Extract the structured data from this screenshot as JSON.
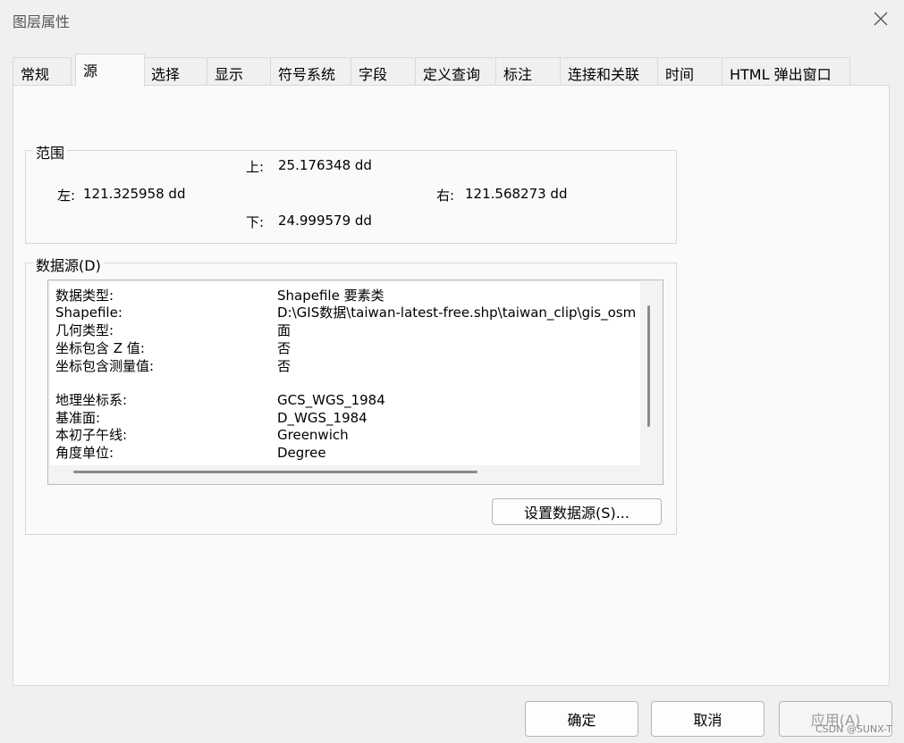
{
  "window": {
    "title": "图层属性",
    "close_icon": "close-icon"
  },
  "tabs": [
    {
      "label": "常规"
    },
    {
      "label": "源",
      "active": true
    },
    {
      "label": "选择"
    },
    {
      "label": "显示"
    },
    {
      "label": "符号系统"
    },
    {
      "label": "字段"
    },
    {
      "label": "定义查询"
    },
    {
      "label": "标注"
    },
    {
      "label": "连接和关联"
    },
    {
      "label": "时间"
    },
    {
      "label": "HTML 弹出窗口"
    }
  ],
  "extent": {
    "legend": "范围",
    "top_label": "上:",
    "top_value": "25.176348 dd",
    "left_label": "左:",
    "left_value": "121.325958 dd",
    "right_label": "右:",
    "right_value": "121.568273 dd",
    "bottom_label": "下:",
    "bottom_value": "24.999579 dd"
  },
  "datasource": {
    "legend": "数据源(D)",
    "rows": [
      {
        "key": "数据类型:",
        "value": "Shapefile 要素类"
      },
      {
        "key": "Shapefile:",
        "value": "D:\\GIS数据\\taiwan-latest-free.shp\\taiwan_clip\\gis_osm"
      },
      {
        "key": "几何类型:",
        "value": "面"
      },
      {
        "key": "坐标包含 Z 值:",
        "value": "否"
      },
      {
        "key": "坐标包含测量值:",
        "value": "否"
      },
      {
        "key": "地理坐标系:",
        "value": "GCS_WGS_1984"
      },
      {
        "key": "基准面:",
        "value": "D_WGS_1984"
      },
      {
        "key": "本初子午线:",
        "value": "Greenwich"
      },
      {
        "key": "角度单位:",
        "value": "Degree"
      }
    ],
    "set_button": "设置数据源(S)..."
  },
  "footer": {
    "ok": "确定",
    "cancel": "取消",
    "apply": "应用(A)"
  },
  "watermark": "CSDN @SUNX-T"
}
